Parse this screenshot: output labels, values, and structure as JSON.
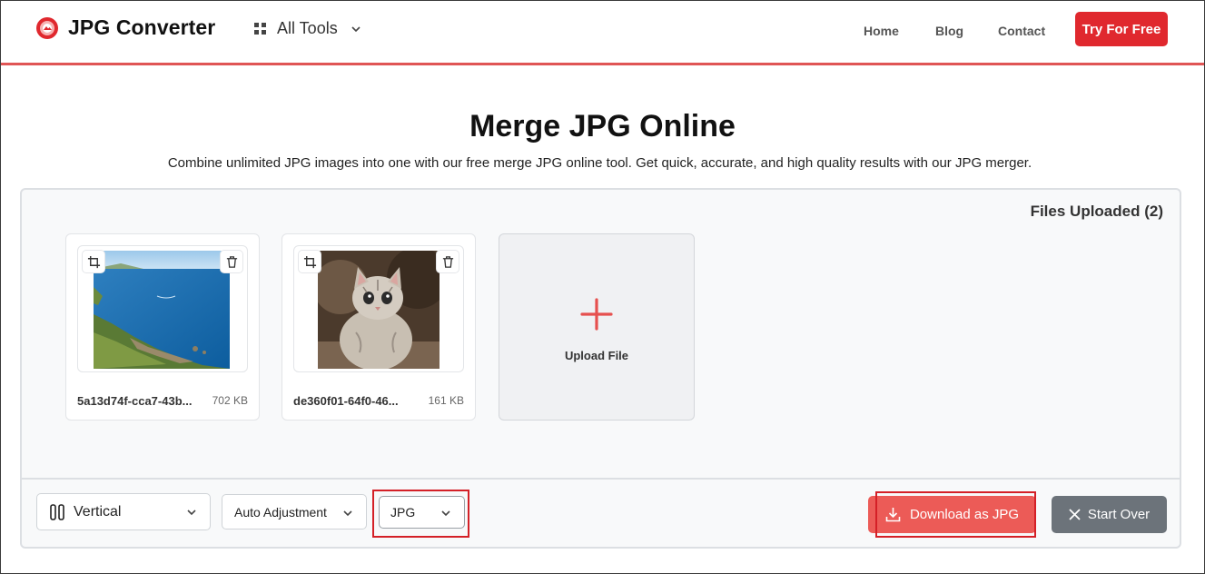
{
  "header": {
    "app_name": "JPG Converter",
    "all_tools_label": "All Tools",
    "nav": [
      {
        "label": "Home"
      },
      {
        "label": "Blog"
      },
      {
        "label": "Contact"
      }
    ],
    "cta_label": "Try For Free"
  },
  "hero": {
    "title": "Merge JPG Online",
    "subtitle": "Combine unlimited JPG images into one with our free merge JPG online tool. Get quick, accurate, and high quality results with our JPG merger."
  },
  "workspace": {
    "files_uploaded_label": "Files Uploaded (2)",
    "files": [
      {
        "name": "5a13d74f-cca7-43b...",
        "size": "702 KB",
        "thumbnail": "coastline-photo"
      },
      {
        "name": "de360f01-64f0-46...",
        "size": "161 KB",
        "thumbnail": "cat-photo"
      }
    ],
    "upload_label": "Upload File"
  },
  "toolbar": {
    "orientation_value": "Vertical",
    "adjustment_value": "Auto Adjustment",
    "format_value": "JPG",
    "download_label": "Download as JPG",
    "start_over_label": "Start Over"
  },
  "colors": {
    "brand_red": "#e0282e",
    "download_button": "#ec5b57",
    "start_over_button": "#6c737a",
    "highlight_outline": "#d42027"
  }
}
